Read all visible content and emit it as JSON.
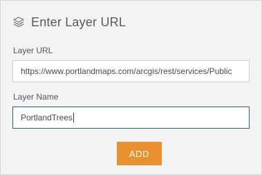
{
  "header": {
    "icon": "layers-icon",
    "title": "Enter Layer URL"
  },
  "layer_url": {
    "label": "Layer URL",
    "value": "https://www.portlandmaps.com/arcgis/rest/services/Public"
  },
  "layer_name": {
    "label": "Layer Name",
    "value": "PortlandTrees"
  },
  "actions": {
    "add_label": "ADD"
  },
  "colors": {
    "accent": "#e8912e",
    "focus_border": "#2f5a87",
    "panel_background": "#f3f3f3"
  }
}
